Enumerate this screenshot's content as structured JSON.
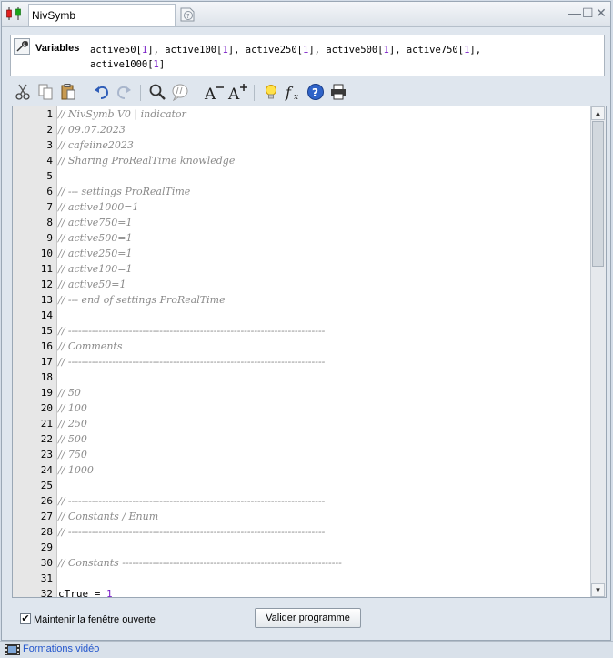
{
  "window": {
    "tab_title": "NivSymb",
    "icons": {
      "app": "candlestick-chart-icon",
      "help_doc": "help-document-icon",
      "minimize": "minimize-icon",
      "maximize": "maximize-icon",
      "close": "close-icon"
    },
    "minimize_glyph": "—",
    "maximize_glyph": "☐",
    "close_glyph": "✕"
  },
  "variables": {
    "label": "Variables",
    "icon": "wrench-icon",
    "items": [
      {
        "name": "active50",
        "index": "1"
      },
      {
        "name": "active100",
        "index": "1"
      },
      {
        "name": "active250",
        "index": "1"
      },
      {
        "name": "active500",
        "index": "1"
      },
      {
        "name": "active750",
        "index": "1"
      },
      {
        "name": "active1000",
        "index": "1"
      }
    ]
  },
  "toolbar": {
    "items": [
      "cut-icon",
      "copy-icon",
      "paste-icon",
      "undo-icon",
      "redo-icon",
      "search-icon",
      "comment-icon",
      "decrease-font-icon",
      "increase-font-icon",
      "lightbulb-icon",
      "function-icon",
      "help-icon",
      "print-icon"
    ]
  },
  "editor": {
    "lines": [
      {
        "n": "1",
        "text": "// NivSymb V0 | indicator",
        "kind": "comment"
      },
      {
        "n": "2",
        "text": "// 09.07.2023",
        "kind": "comment"
      },
      {
        "n": "3",
        "text": "// cafeiine2023",
        "kind": "comment"
      },
      {
        "n": "4",
        "text": "// Sharing ProRealTime knowledge",
        "kind": "comment"
      },
      {
        "n": "5",
        "text": "",
        "kind": "comment"
      },
      {
        "n": "6",
        "text": "// --- settings ProRealTime",
        "kind": "comment"
      },
      {
        "n": "7",
        "text": "// active1000=1",
        "kind": "comment"
      },
      {
        "n": "8",
        "text": "// active750=1",
        "kind": "comment"
      },
      {
        "n": "9",
        "text": "// active500=1",
        "kind": "comment"
      },
      {
        "n": "10",
        "text": "// active250=1",
        "kind": "comment"
      },
      {
        "n": "11",
        "text": "// active100=1",
        "kind": "comment"
      },
      {
        "n": "12",
        "text": "// active50=1",
        "kind": "comment"
      },
      {
        "n": "13",
        "text": "// --- end of settings ProRealTime",
        "kind": "comment"
      },
      {
        "n": "14",
        "text": "",
        "kind": "comment"
      },
      {
        "n": "15",
        "text": "// ----------------------------------------------------------------------------",
        "kind": "comment"
      },
      {
        "n": "16",
        "text": "// Comments",
        "kind": "comment"
      },
      {
        "n": "17",
        "text": "// ----------------------------------------------------------------------------",
        "kind": "comment"
      },
      {
        "n": "18",
        "text": "",
        "kind": "comment"
      },
      {
        "n": "19",
        "text": "// 50",
        "kind": "comment"
      },
      {
        "n": "20",
        "text": "// 100",
        "kind": "comment"
      },
      {
        "n": "21",
        "text": "// 250",
        "kind": "comment"
      },
      {
        "n": "22",
        "text": "// 500",
        "kind": "comment"
      },
      {
        "n": "23",
        "text": "// 750",
        "kind": "comment"
      },
      {
        "n": "24",
        "text": "// 1000",
        "kind": "comment"
      },
      {
        "n": "25",
        "text": "",
        "kind": "comment"
      },
      {
        "n": "26",
        "text": "// ----------------------------------------------------------------------------",
        "kind": "comment"
      },
      {
        "n": "27",
        "text": "// Constants / Enum",
        "kind": "comment"
      },
      {
        "n": "28",
        "text": "// ----------------------------------------------------------------------------",
        "kind": "comment"
      },
      {
        "n": "29",
        "text": "",
        "kind": "comment"
      },
      {
        "n": "30",
        "text": "// Constants -----------------------------------------------------------------",
        "kind": "comment"
      },
      {
        "n": "31",
        "text": "",
        "kind": "comment"
      },
      {
        "n": "32",
        "text": "cTrue = ",
        "value": "1",
        "kind": "plain"
      }
    ]
  },
  "footer": {
    "keep_open_label": "Maintenir la fenêtre ouverte",
    "keep_open_checked": true,
    "check_glyph": "✔",
    "validate_button": "Valider programme"
  },
  "statusbar": {
    "icon": "film-icon",
    "link": "Formations vidéo"
  },
  "colors": {
    "comment": "#8a8a8a",
    "number": "#7a20c8",
    "link": "#2255cc"
  }
}
